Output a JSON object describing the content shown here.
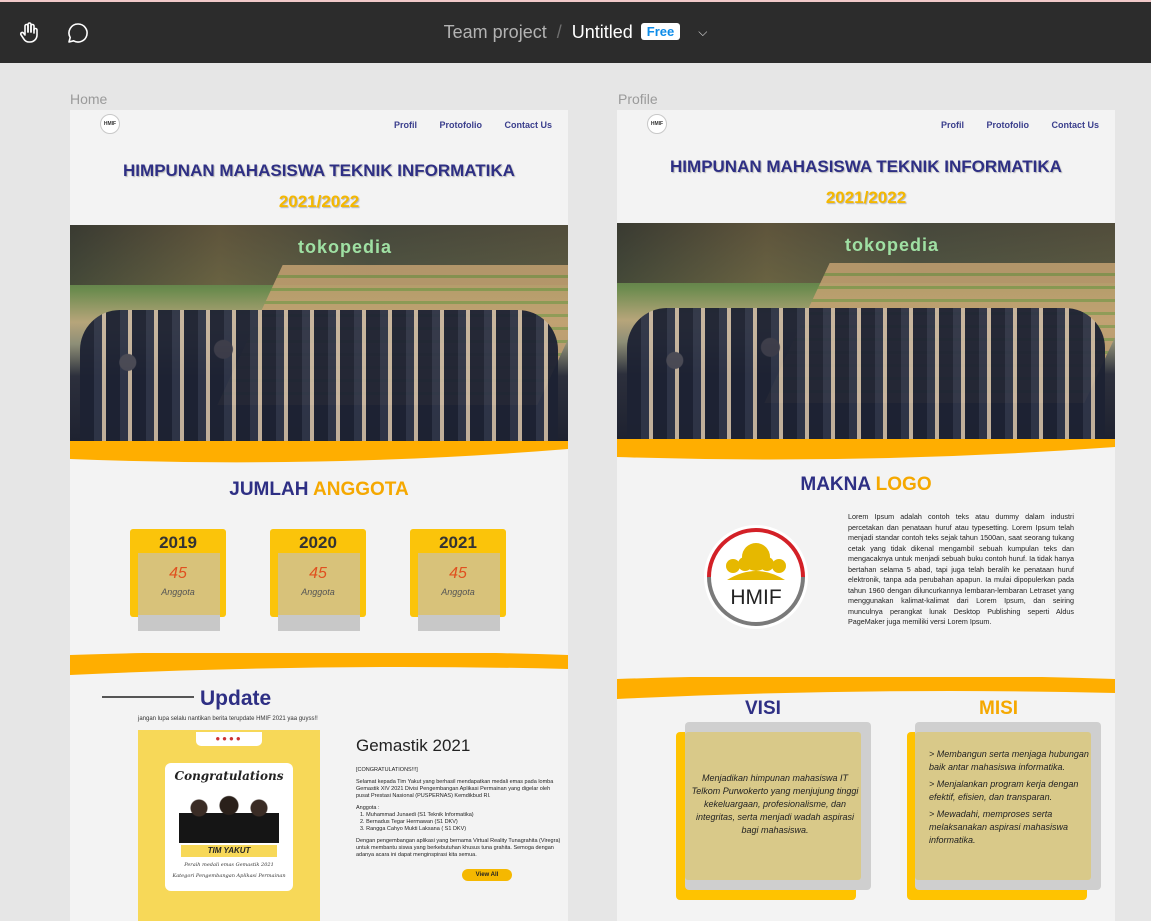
{
  "topbar": {
    "team": "Team project",
    "separator": "/",
    "file": "Untitled",
    "badge": "Free",
    "hand_tool": "hand-icon",
    "comment_tool": "comment-icon",
    "menu": "chevron-down-icon"
  },
  "frames": {
    "home_label": "Home",
    "profile_label": "Profile"
  },
  "nav": {
    "logo": "HMIF",
    "links": [
      "Profil",
      "Protofolio",
      "Contact Us"
    ]
  },
  "hero": {
    "title": "HIMPUNAN MAHASISWA TEKNIK INFORMATIKA",
    "year": "2021/2022",
    "photo_brand": "tokopedia"
  },
  "home": {
    "members_heading_a": "JUMLAH",
    "members_heading_b": "ANGGOTA",
    "cards": [
      {
        "year": "2019",
        "count": "45",
        "label": "Anggota"
      },
      {
        "year": "2020",
        "count": "45",
        "label": "Anggota"
      },
      {
        "year": "2021",
        "count": "45",
        "label": "Anggota"
      }
    ],
    "update_title": "Update",
    "update_subtitle": "jangan lupa selalu nantikan berita terupdate HMIF 2021 yaa guyss!!",
    "poster": {
      "heading": "Congratulations",
      "team": "TIM YAKUT",
      "caption1": "Peraih medali emas Gemastik 2021",
      "caption2": "Kategori Pengembangan Aplikasi Permainan"
    },
    "news": {
      "title": "Gemastik 2021",
      "tag": "[CONGRATULATIONS!!!]",
      "para1": "Selamat kepada Tim Yakut yang berhasil mendapatkan medali emas pada lomba Gemastik XIV 2021 Divisi Pengembangan Aplikasi Permainan yang digelar oleh pusat Prestasi Nasional (PUSPERNAS) Kemdikbud RI.",
      "members_label": "Anggota :",
      "members": [
        "1. Muhammad Junaedi (S1 Teknik Informatika)",
        "2. Bernadus Tegar Hermawan (S1 DKV)",
        "3. Rangga Cahyo Mukti Laksana ( S1 DKV)"
      ],
      "para2": "Dengan pengembangan aplikasi yang bernama Virtual Reality Tunagrahita (Viregra) untuk membantu siswa yang berkebutuhan khusus tuna grahita. Semoga dengan adanya acara ini dapat menginspirasi kita semua.",
      "button": "View All"
    }
  },
  "profile": {
    "logo_heading_a": "MAKNA",
    "logo_heading_b": "LOGO",
    "logo_text": "HMIF",
    "lorem": "Lorem Ipsum adalah contoh teks atau dummy dalam industri percetakan dan penataan huruf atau typesetting. Lorem Ipsum telah menjadi standar contoh teks sejak tahun 1500an, saat seorang tukang cetak yang tidak dikenal mengambil sebuah kumpulan teks dan mengacaknya untuk menjadi sebuah buku contoh huruf. Ia tidak hanya bertahan selama 5 abad, tapi juga telah beralih ke penataan huruf elektronik, tanpa ada perubahan apapun. Ia mulai dipopulerkan pada tahun 1960 dengan diluncurkannya lembaran-lembaran Letraset yang menggunakan kalimat-kalimat dari Lorem Ipsum, dan seiring munculnya perangkat lunak Desktop Publishing seperti Aldus PageMaker juga memiliki versi Lorem Ipsum.",
    "visi_title": "VISI",
    "visi_text": "Menjadikan himpunan mahasiswa IT Telkom Purwokerto yang menjujung tinggi kekeluargaan, profesionalisme, dan integritas, serta menjadi wadah aspirasi bagi mahasiswa.",
    "misi_title": "MISI",
    "misi_items": [
      "> Membangun serta menjaga hubungan baik antar mahasiswa informatika.",
      "> Menjalankan program kerja dengan efektif, efisien, dan transparan.",
      "> Mewadahi, memproses serta melaksanakan aspirasi mahasiswa informatika."
    ]
  },
  "colors": {
    "navy": "#2e2f84",
    "gold": "#f5b800",
    "orange": "#f5a800",
    "topbar": "#2c2c2c",
    "badge_text": "#0d8ce9"
  }
}
